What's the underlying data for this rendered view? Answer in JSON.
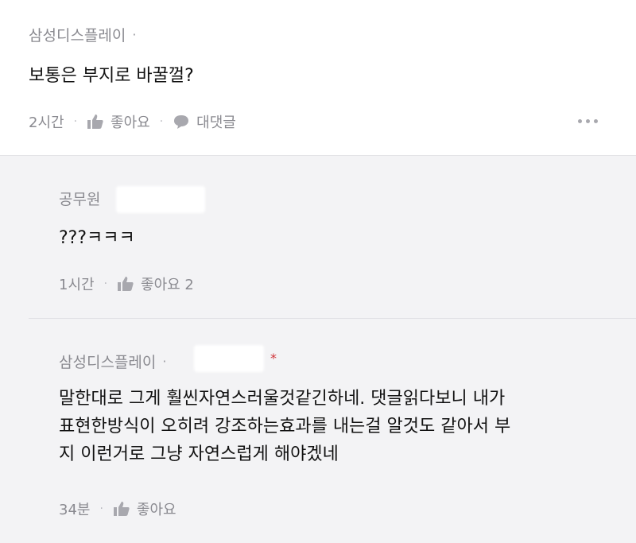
{
  "top_comment": {
    "author": "삼성디스플레이",
    "dot": "·",
    "text": "보통은 부지로 바꿀껄?",
    "time": "2시간",
    "like_label": "좋아요",
    "reply_label": "대댓글",
    "more_icon": "ellipsis-icon"
  },
  "replies": [
    {
      "author": "공무원",
      "text": "???ㅋㅋㅋ",
      "time": "1시간",
      "like_label": "좋아요 2"
    },
    {
      "author": "삼성디스플레이",
      "dot": "·",
      "star": "*",
      "text_lines": [
        "말한대로 그게 훨씬자연스러울것같긴하네. 댓글읽다보니 내가",
        "표현한방식이 오히려 강조하는효과를 내는걸 알것도 같아서 부",
        "지 이런거로 그냥 자연스럽게 해야겠네"
      ],
      "time": "34분",
      "like_label": "좋아요"
    }
  ],
  "colors": {
    "reply_background": "#f3f3f5",
    "meta_text": "#8a8a90",
    "author_mark": "#d0353a"
  }
}
